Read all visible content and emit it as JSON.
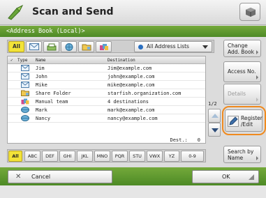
{
  "header": {
    "title": "Scan and Send",
    "logo_icon": "scan-send-icon",
    "right_icon": "cube-icon"
  },
  "breadcrumb": "<Address Book (Local)>",
  "filters": {
    "all_label": "All",
    "type_icons": [
      "email-icon",
      "fax-icon",
      "ifax-icon",
      "file-server-icon",
      "group-icon"
    ],
    "address_list": "All Address Lists"
  },
  "list": {
    "columns": [
      "Type",
      "Name",
      "Destination"
    ],
    "rows": [
      {
        "icon": "email-icon",
        "name": "Jim",
        "destination": "Jim@example.com"
      },
      {
        "icon": "email-icon",
        "name": "John",
        "destination": "john@example.com"
      },
      {
        "icon": "email-icon",
        "name": "Mike",
        "destination": "mike@example.com"
      },
      {
        "icon": "file-server-icon",
        "name": "Share Folder",
        "destination": "starfish.organization.com"
      },
      {
        "icon": "group-icon",
        "name": "Manual team",
        "destination": "4 destinations"
      },
      {
        "icon": "ifax-icon",
        "name": "Mark",
        "destination": "mark@example.com"
      },
      {
        "icon": "ifax-icon",
        "name": "Nancy",
        "destination": "nancy@example.com"
      }
    ],
    "dest_label": "Dest.:",
    "dest_count": "0"
  },
  "pager": "1/2",
  "alphabet": [
    "All",
    "ABC",
    "DEF",
    "GHI",
    "JKL",
    "MNO",
    "PQR",
    "STU",
    "VWX",
    "YZ",
    "0-9"
  ],
  "side_buttons": {
    "change_addbook_line1": "Change",
    "change_addbook_line2": "Add. Book",
    "access_no": "Access No.",
    "details": "Details",
    "register_line1": "Register",
    "register_line2": "/Edit",
    "search_line1": "Search by",
    "search_line2": "Name"
  },
  "bottom": {
    "cancel": "Cancel",
    "ok": "OK"
  },
  "colors": {
    "accent_green": "#5e9a2e",
    "selected_yellow": "#f2e338",
    "highlight_orange": "#f08a1e"
  }
}
